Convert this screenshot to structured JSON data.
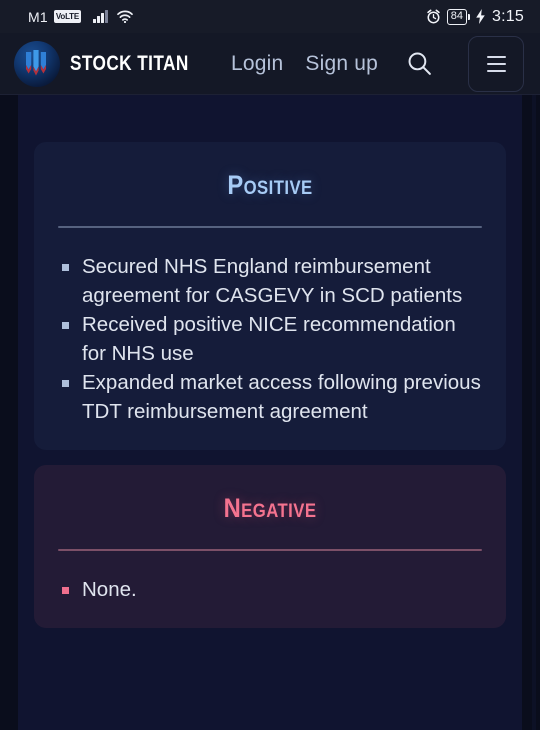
{
  "statusbar": {
    "carrier": "M1",
    "volte_badge": "VoLTE",
    "signal_icon": "cellular-signal-icon",
    "wifi_icon": "wifi-icon",
    "alarm_icon": "alarm-clock-icon",
    "battery_level": "84",
    "charging_icon": "lightning-bolt-icon",
    "time": "3:15"
  },
  "navbar": {
    "logo_icon": "stock-titan-logo-icon",
    "brand_name": "STOCK TITAN",
    "login_label": "Login",
    "signup_label": "Sign up",
    "search_icon": "search-icon",
    "menu_icon": "hamburger-menu-icon"
  },
  "cards": [
    {
      "id": "positive",
      "title": "Positive",
      "accent": "#a7cbf5",
      "bullet_color": "#aebfdb",
      "items": [
        "Secured NHS England reimbursement agreement for CASGEVY in SCD patients",
        "Received positive NICE recommendation for NHS use",
        "Expanded market access following previous TDT reimbursement agreement"
      ]
    },
    {
      "id": "negative",
      "title": "Negative",
      "accent": "#f4738f",
      "bullet_color": "#ef6f8e",
      "items": [
        "None."
      ]
    }
  ],
  "colors": {
    "page_background": "#0a0d1c",
    "content_background": "#101430",
    "navbar_background": "#141826",
    "statusbar_background": "#171b28",
    "positive_card": "#151c3a",
    "negative_card": "#231b36"
  }
}
